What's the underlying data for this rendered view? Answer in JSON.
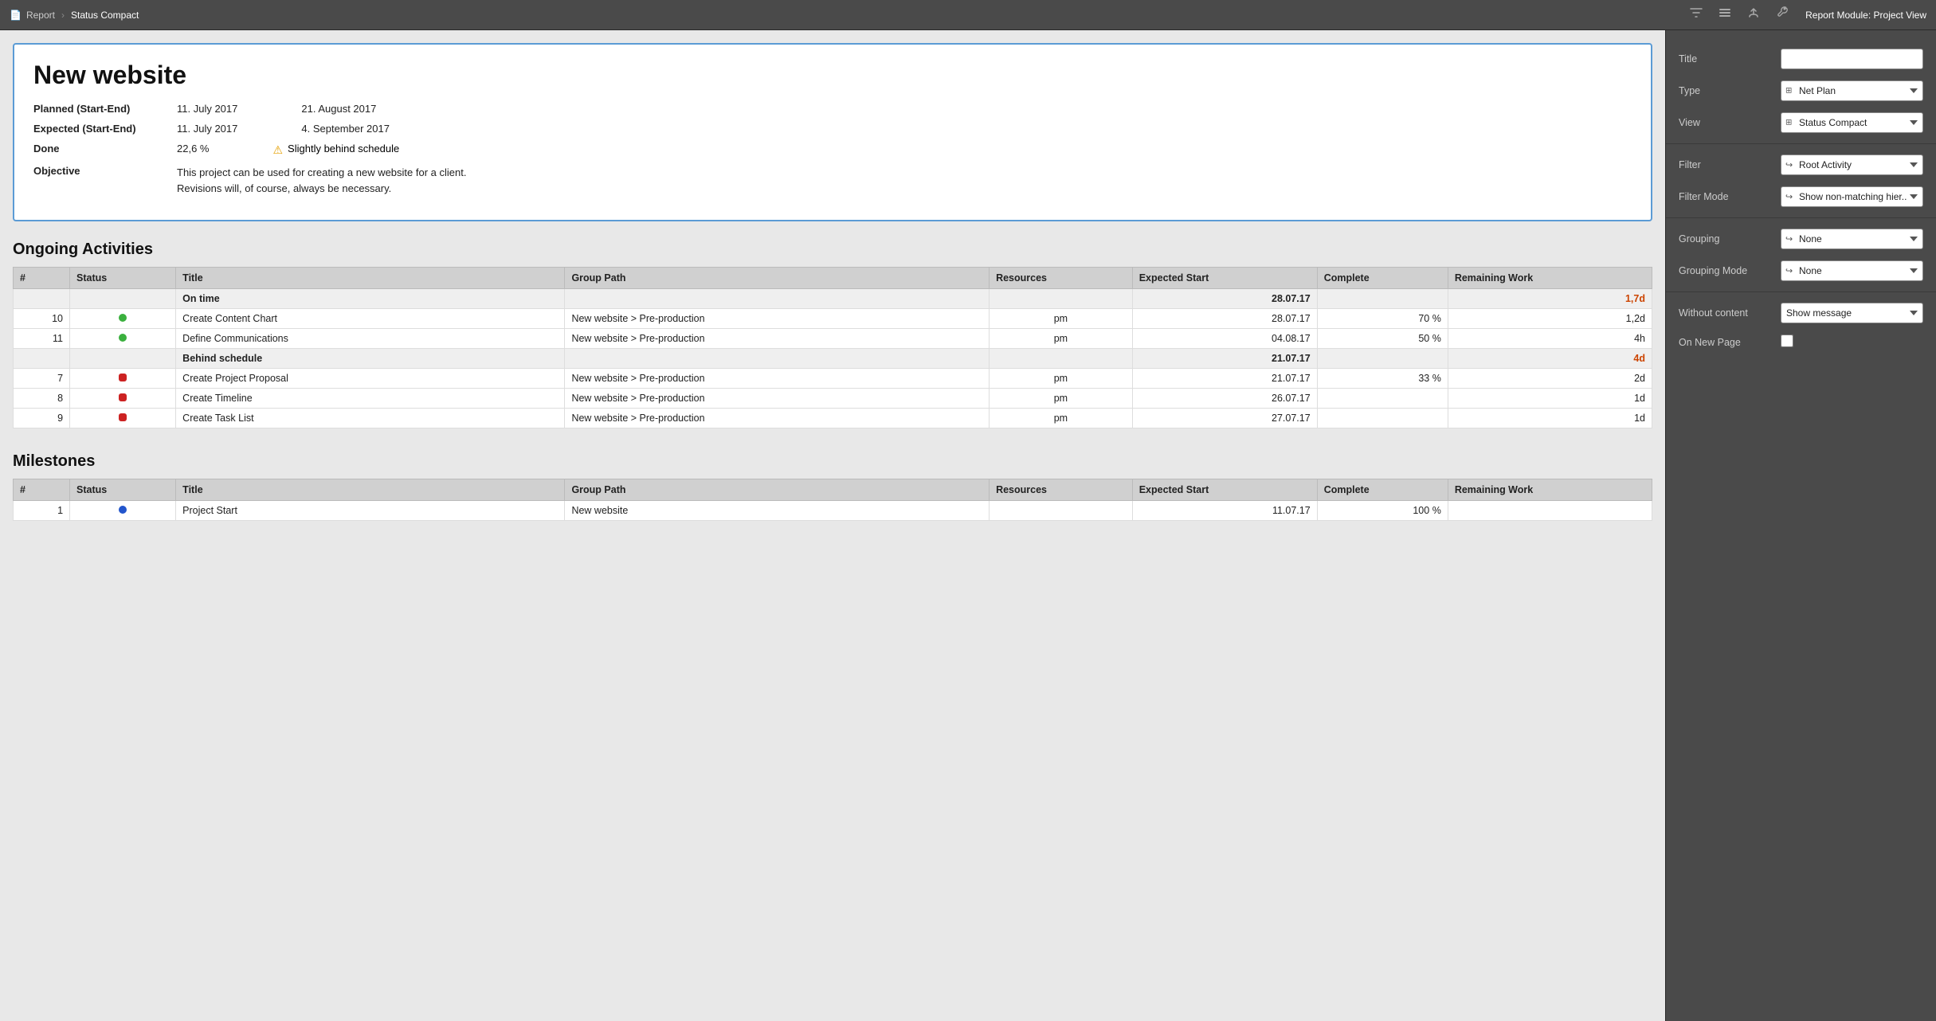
{
  "topbar": {
    "doc_icon": "📄",
    "breadcrumb_parent": "Report",
    "breadcrumb_separator": "›",
    "breadcrumb_current": "Status Compact",
    "icons": [
      "filter",
      "list",
      "brush",
      "wrench"
    ],
    "module_label": "Report Module:",
    "module_value": "Project View"
  },
  "project": {
    "title": "New website",
    "planned_label": "Planned (Start-End)",
    "planned_start": "11. July 2017",
    "planned_end": "21. August 2017",
    "expected_label": "Expected (Start-End)",
    "expected_start": "11. July 2017",
    "expected_end": "4. September 2017",
    "done_label": "Done",
    "done_value": "22,6 %",
    "done_status": "Slightly behind schedule",
    "objective_label": "Objective",
    "objective_text": "This project can be used for creating a new website for a client. Revisions will, of course, always be necessary."
  },
  "ongoing": {
    "section_title": "Ongoing Activities",
    "columns": [
      "#",
      "Status",
      "Title",
      "Group Path",
      "Resources",
      "Expected Start",
      "Complete",
      "Remaining Work"
    ],
    "groups": [
      {
        "group_name": "On time",
        "expected_start": "28.07.17",
        "remaining": "1,7d",
        "rows": [
          {
            "num": "10",
            "status": "green",
            "title": "Create Content Chart",
            "group_path": "New website > Pre-production",
            "resources": "pm",
            "exp_start": "28.07.17",
            "complete": "70 %",
            "remaining": "1,2d"
          },
          {
            "num": "11",
            "status": "green",
            "title": "Define Communications",
            "group_path": "New website > Pre-production",
            "resources": "pm",
            "exp_start": "04.08.17",
            "complete": "50 %",
            "remaining": "4h"
          }
        ]
      },
      {
        "group_name": "Behind schedule",
        "expected_start": "21.07.17",
        "remaining": "4d",
        "rows": [
          {
            "num": "7",
            "status": "red",
            "title": "Create Project Proposal",
            "group_path": "New website > Pre-production",
            "resources": "pm",
            "exp_start": "21.07.17",
            "complete": "33 %",
            "remaining": "2d"
          },
          {
            "num": "8",
            "status": "red",
            "title": "Create Timeline",
            "group_path": "New website > Pre-production",
            "resources": "pm",
            "exp_start": "26.07.17",
            "complete": "",
            "remaining": "1d"
          },
          {
            "num": "9",
            "status": "red",
            "title": "Create Task List",
            "group_path": "New website > Pre-production",
            "resources": "pm",
            "exp_start": "27.07.17",
            "complete": "",
            "remaining": "1d"
          }
        ]
      }
    ]
  },
  "milestones": {
    "section_title": "Milestones",
    "columns": [
      "#",
      "Status",
      "Title",
      "Group Path",
      "Resources",
      "Expected Start",
      "Complete",
      "Remaining Work"
    ],
    "partial_row": {
      "num": "1",
      "title": "Project Start",
      "group_path": "New website",
      "exp_start": "11.07.17",
      "complete": "100 %"
    }
  },
  "sidebar": {
    "title_label": "Title",
    "title_value": "",
    "type_label": "Type",
    "type_value": "Net Plan",
    "type_icon": "≡",
    "view_label": "View",
    "view_value": "Status Compact",
    "view_icon": "≡",
    "filter_label": "Filter",
    "filter_value": "Root Activity",
    "filter_icon": "↪",
    "filter_mode_label": "Filter Mode",
    "filter_mode_value": "Show non-matching hier...",
    "filter_mode_icon": "↪",
    "grouping_label": "Grouping",
    "grouping_value": "None",
    "grouping_icon": "↪",
    "grouping_mode_label": "Grouping Mode",
    "grouping_mode_value": "None",
    "grouping_mode_icon": "↪",
    "without_content_label": "Without content",
    "without_content_value": "Show message",
    "on_new_page_label": "On New Page"
  }
}
